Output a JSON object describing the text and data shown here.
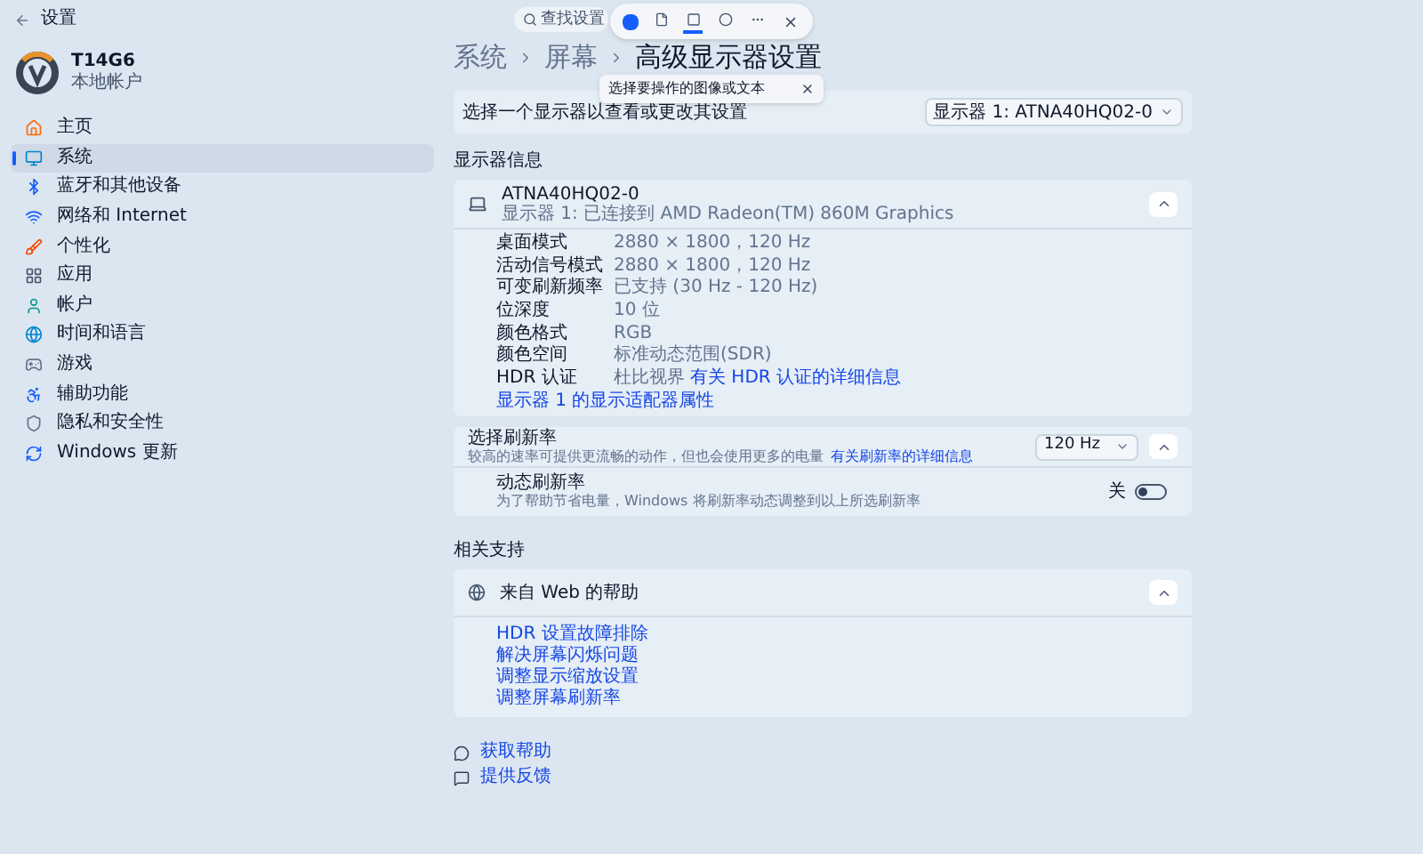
{
  "window": {
    "title": "设置"
  },
  "search": {
    "placeholder": "查找设置"
  },
  "account": {
    "name": "T14G6",
    "type": "本地帐户"
  },
  "sidebar": {
    "items": [
      {
        "label": "主页",
        "selected": false
      },
      {
        "label": "系统",
        "selected": true
      },
      {
        "label": "蓝牙和其他设备",
        "selected": false
      },
      {
        "label": "网络和 Internet",
        "selected": false
      },
      {
        "label": "个性化",
        "selected": false
      },
      {
        "label": "应用",
        "selected": false
      },
      {
        "label": "帐户",
        "selected": false
      },
      {
        "label": "时间和语言",
        "selected": false
      },
      {
        "label": "游戏",
        "selected": false
      },
      {
        "label": "辅助功能",
        "selected": false
      },
      {
        "label": "隐私和安全性",
        "selected": false
      },
      {
        "label": "Windows 更新",
        "selected": false
      }
    ]
  },
  "snip_toolbar": {
    "tools": [
      {
        "selected": false
      },
      {
        "selected": true
      },
      {
        "selected": false
      },
      {
        "selected": false
      }
    ]
  },
  "tooltip": {
    "text": "选择要操作的图像或文本"
  },
  "breadcrumb": [
    "系统",
    "屏幕",
    "高级显示器设置"
  ],
  "display_select": {
    "label": "选择一个显示器以查看或更改其设置",
    "value": "显示器 1: ATNA40HQ02-0"
  },
  "display_info": {
    "heading": "显示器信息",
    "name": "ATNA40HQ02-0",
    "subtitle": "显示器 1: 已连接到 AMD Radeon(TM) 860M Graphics",
    "expanded": true,
    "rows": [
      {
        "label": "桌面模式",
        "value": "2880 × 1800，120 Hz"
      },
      {
        "label": "活动信号模式",
        "value": "2880 × 1800，120 Hz"
      },
      {
        "label": "可变刷新频率",
        "value": "已支持 (30 Hz - 120 Hz)"
      },
      {
        "label": "位深度",
        "value": "10 位"
      },
      {
        "label": "颜色格式",
        "value": "RGB"
      },
      {
        "label": "颜色空间",
        "value": "标准动态范围(SDR)"
      },
      {
        "label": "HDR 认证",
        "value": "杜比视界",
        "link": "有关 HDR 认证的详细信息"
      }
    ],
    "adapter_link": "显示器 1 的显示适配器属性"
  },
  "refresh": {
    "title": "选择刷新率",
    "description": "较高的速率可提供更流畅的动作，但也会使用更多的电量",
    "link": "有关刷新率的详细信息",
    "value": "120 Hz",
    "expanded": true,
    "dynamic": {
      "title": "动态刷新率",
      "description": "为了帮助节省电量，Windows 将刷新率动态调整到以上所选刷新率",
      "toggle_label": "关",
      "on": false
    }
  },
  "related": {
    "heading": "相关支持",
    "card_title": "来自 Web 的帮助",
    "expanded": true,
    "links": [
      "HDR 设置故障排除",
      "解决屏幕闪烁问题",
      "调整显示缩放设置",
      "调整屏幕刷新率"
    ]
  },
  "footer_links": [
    "获取帮助",
    "提供反馈"
  ]
}
